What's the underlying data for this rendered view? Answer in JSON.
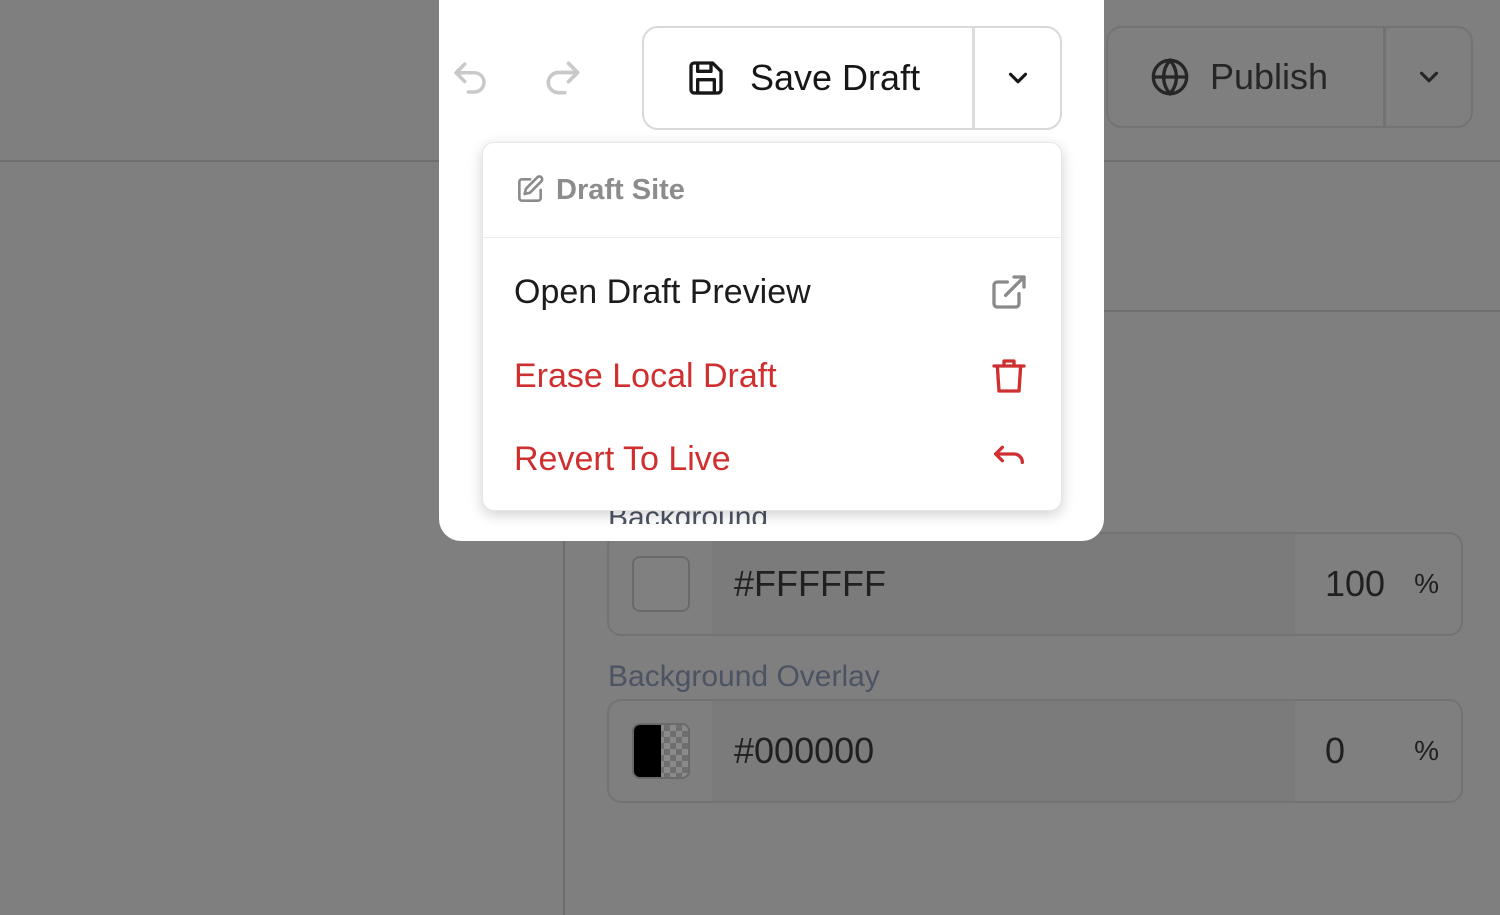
{
  "toolbar": {
    "save_label": "Save Draft",
    "publish_label": "Publish"
  },
  "draft_menu": {
    "header": "Draft Site",
    "items": [
      {
        "label": "Open Draft Preview",
        "icon": "external-link-icon"
      },
      {
        "label": "Erase Local Draft",
        "icon": "trash-icon"
      },
      {
        "label": "Revert To Live",
        "icon": "undo-icon"
      }
    ]
  },
  "properties": {
    "background": {
      "label": "Background",
      "hex": "#FFFFFF",
      "opacity": "100",
      "unit": "%"
    },
    "background_overlay": {
      "label": "Background Overlay",
      "hex": "#000000",
      "opacity": "0",
      "unit": "%"
    }
  },
  "colors": {
    "danger": "#d02f30",
    "overlay": "#7f7f7f"
  }
}
